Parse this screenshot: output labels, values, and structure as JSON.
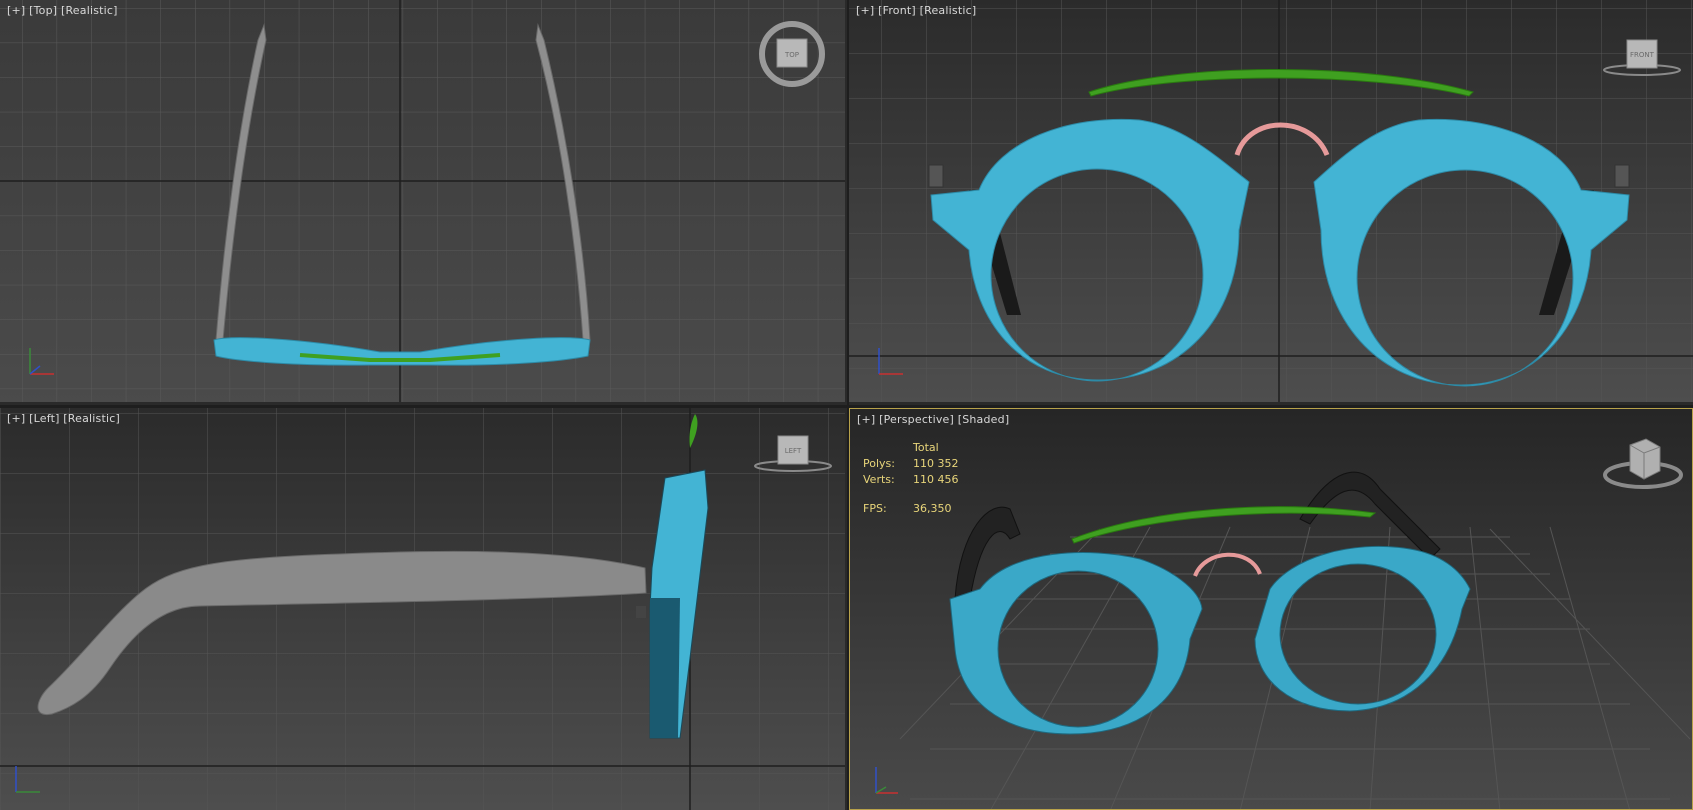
{
  "viewports": {
    "top": {
      "plus": "[+]",
      "view": "[Top]",
      "mode": "[Realistic]",
      "cube_face": "TOP"
    },
    "front": {
      "plus": "[+]",
      "view": "[Front]",
      "mode": "[Realistic]",
      "cube_face": "FRONT"
    },
    "left": {
      "plus": "[+]",
      "view": "[Left]",
      "mode": "[Realistic]",
      "cube_face": "LEFT"
    },
    "perspective": {
      "plus": "[+]",
      "view": "[Perspective]",
      "mode": "[Shaded]"
    }
  },
  "stats": {
    "total_label": "Total",
    "polys_label": "Polys:",
    "polys_value": "110 352",
    "verts_label": "Verts:",
    "verts_value": "110 456",
    "fps_label": "FPS:",
    "fps_value": "36,350"
  },
  "colors": {
    "frame": "#43b4d4",
    "temple_gray": "#8a8a8a",
    "temple_black": "#1a1a1a",
    "bridge_green": "#3fa020",
    "nosepad_pink": "#e69a9a",
    "active_border": "#b8a24a",
    "stats_text": "#e8d57a"
  },
  "axis_icons": [
    "axis-tripod-icon"
  ]
}
